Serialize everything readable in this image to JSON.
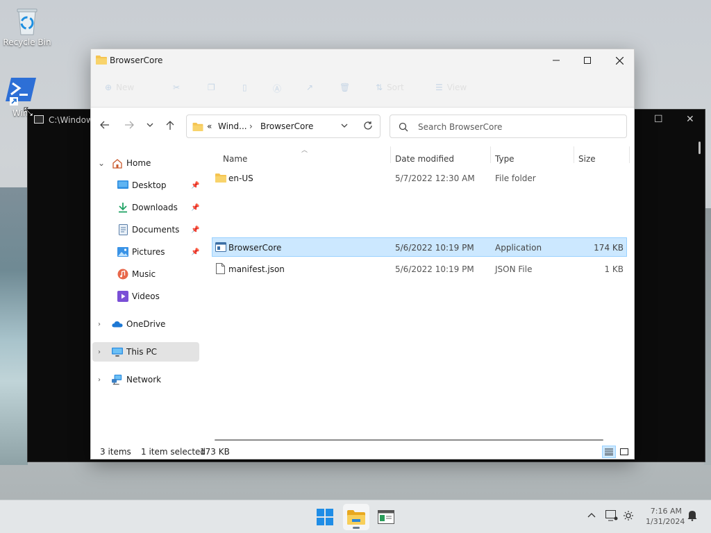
{
  "desktop": {
    "icons": [
      {
        "label": "Recycle Bin"
      },
      {
        "label": "Win"
      }
    ]
  },
  "terminal": {
    "title": "C:\\Windows"
  },
  "explorer": {
    "title": "BrowserCore",
    "address": {
      "overflow": "«",
      "parent": "Wind...",
      "current": "BrowserCore"
    },
    "search": {
      "placeholder": "Search BrowserCore"
    },
    "toolbar": {
      "new_label": "New",
      "sort_label": "Sort",
      "view_label": "View"
    },
    "sidebar": [
      {
        "label": "Home",
        "expandable": true,
        "expanded": true
      },
      {
        "label": "Desktop",
        "pinned": true
      },
      {
        "label": "Downloads",
        "pinned": true
      },
      {
        "label": "Documents",
        "pinned": true
      },
      {
        "label": "Pictures",
        "pinned": true
      },
      {
        "label": "Music"
      },
      {
        "label": "Videos"
      },
      {
        "label": "OneDrive",
        "expandable": true
      },
      {
        "label": "This PC",
        "expandable": true,
        "selected": true
      },
      {
        "label": "Network",
        "expandable": true
      }
    ],
    "columns": [
      "Name",
      "Date modified",
      "Type",
      "Size"
    ],
    "files": [
      {
        "name": "en-US",
        "date": "5/7/2022 12:30 AM",
        "type": "File folder",
        "size": "",
        "icon": "folder-icon"
      },
      {
        "name": "BrowserCore",
        "date": "5/6/2022 10:19 PM",
        "type": "Application",
        "size": "174 KB",
        "icon": "application-icon",
        "selected": true
      },
      {
        "name": "manifest.json",
        "date": "5/6/2022 10:19 PM",
        "type": "JSON File",
        "size": "1 KB",
        "icon": "file-icon"
      }
    ],
    "status": {
      "items": "3 items",
      "selection": "1 item selected",
      "size": "173 KB"
    }
  },
  "taskbar": {
    "clock_time": "7:16 AM",
    "clock_date": "1/31/2024"
  },
  "colors": {
    "selection": "#cce8ff",
    "selection_border": "#99d1ff",
    "folder": "#f5c451"
  }
}
